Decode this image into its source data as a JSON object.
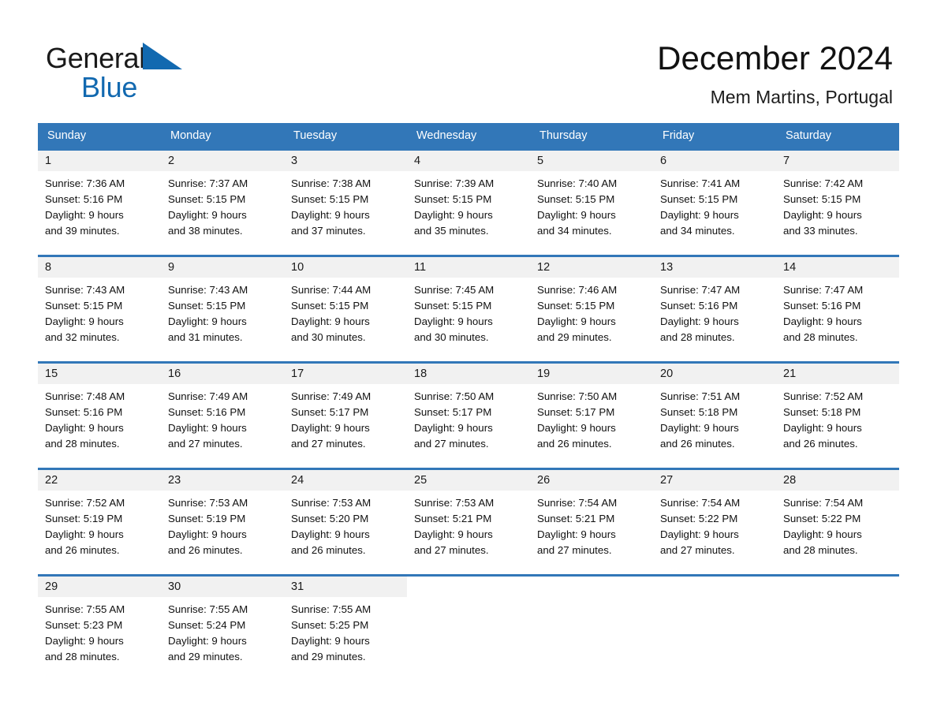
{
  "brand": {
    "word1": "General",
    "word2": "Blue",
    "triangle_color": "#1269b0",
    "text_color": "#1a1a1a"
  },
  "header": {
    "title": "December 2024",
    "subtitle": "Mem Martins, Portugal"
  },
  "theme": {
    "header_blue": "#3277b8",
    "daynum_band": "#f1f1f1",
    "page_background": "#ffffff"
  },
  "calendar": {
    "weekday_headers": [
      "Sunday",
      "Monday",
      "Tuesday",
      "Wednesday",
      "Thursday",
      "Friday",
      "Saturday"
    ],
    "weeks": [
      [
        {
          "day": "1",
          "sunrise": "Sunrise: 7:36 AM",
          "sunset": "Sunset: 5:16 PM",
          "daylight1": "Daylight: 9 hours",
          "daylight2": "and 39 minutes."
        },
        {
          "day": "2",
          "sunrise": "Sunrise: 7:37 AM",
          "sunset": "Sunset: 5:15 PM",
          "daylight1": "Daylight: 9 hours",
          "daylight2": "and 38 minutes."
        },
        {
          "day": "3",
          "sunrise": "Sunrise: 7:38 AM",
          "sunset": "Sunset: 5:15 PM",
          "daylight1": "Daylight: 9 hours",
          "daylight2": "and 37 minutes."
        },
        {
          "day": "4",
          "sunrise": "Sunrise: 7:39 AM",
          "sunset": "Sunset: 5:15 PM",
          "daylight1": "Daylight: 9 hours",
          "daylight2": "and 35 minutes."
        },
        {
          "day": "5",
          "sunrise": "Sunrise: 7:40 AM",
          "sunset": "Sunset: 5:15 PM",
          "daylight1": "Daylight: 9 hours",
          "daylight2": "and 34 minutes."
        },
        {
          "day": "6",
          "sunrise": "Sunrise: 7:41 AM",
          "sunset": "Sunset: 5:15 PM",
          "daylight1": "Daylight: 9 hours",
          "daylight2": "and 34 minutes."
        },
        {
          "day": "7",
          "sunrise": "Sunrise: 7:42 AM",
          "sunset": "Sunset: 5:15 PM",
          "daylight1": "Daylight: 9 hours",
          "daylight2": "and 33 minutes."
        }
      ],
      [
        {
          "day": "8",
          "sunrise": "Sunrise: 7:43 AM",
          "sunset": "Sunset: 5:15 PM",
          "daylight1": "Daylight: 9 hours",
          "daylight2": "and 32 minutes."
        },
        {
          "day": "9",
          "sunrise": "Sunrise: 7:43 AM",
          "sunset": "Sunset: 5:15 PM",
          "daylight1": "Daylight: 9 hours",
          "daylight2": "and 31 minutes."
        },
        {
          "day": "10",
          "sunrise": "Sunrise: 7:44 AM",
          "sunset": "Sunset: 5:15 PM",
          "daylight1": "Daylight: 9 hours",
          "daylight2": "and 30 minutes."
        },
        {
          "day": "11",
          "sunrise": "Sunrise: 7:45 AM",
          "sunset": "Sunset: 5:15 PM",
          "daylight1": "Daylight: 9 hours",
          "daylight2": "and 30 minutes."
        },
        {
          "day": "12",
          "sunrise": "Sunrise: 7:46 AM",
          "sunset": "Sunset: 5:15 PM",
          "daylight1": "Daylight: 9 hours",
          "daylight2": "and 29 minutes."
        },
        {
          "day": "13",
          "sunrise": "Sunrise: 7:47 AM",
          "sunset": "Sunset: 5:16 PM",
          "daylight1": "Daylight: 9 hours",
          "daylight2": "and 28 minutes."
        },
        {
          "day": "14",
          "sunrise": "Sunrise: 7:47 AM",
          "sunset": "Sunset: 5:16 PM",
          "daylight1": "Daylight: 9 hours",
          "daylight2": "and 28 minutes."
        }
      ],
      [
        {
          "day": "15",
          "sunrise": "Sunrise: 7:48 AM",
          "sunset": "Sunset: 5:16 PM",
          "daylight1": "Daylight: 9 hours",
          "daylight2": "and 28 minutes."
        },
        {
          "day": "16",
          "sunrise": "Sunrise: 7:49 AM",
          "sunset": "Sunset: 5:16 PM",
          "daylight1": "Daylight: 9 hours",
          "daylight2": "and 27 minutes."
        },
        {
          "day": "17",
          "sunrise": "Sunrise: 7:49 AM",
          "sunset": "Sunset: 5:17 PM",
          "daylight1": "Daylight: 9 hours",
          "daylight2": "and 27 minutes."
        },
        {
          "day": "18",
          "sunrise": "Sunrise: 7:50 AM",
          "sunset": "Sunset: 5:17 PM",
          "daylight1": "Daylight: 9 hours",
          "daylight2": "and 27 minutes."
        },
        {
          "day": "19",
          "sunrise": "Sunrise: 7:50 AM",
          "sunset": "Sunset: 5:17 PM",
          "daylight1": "Daylight: 9 hours",
          "daylight2": "and 26 minutes."
        },
        {
          "day": "20",
          "sunrise": "Sunrise: 7:51 AM",
          "sunset": "Sunset: 5:18 PM",
          "daylight1": "Daylight: 9 hours",
          "daylight2": "and 26 minutes."
        },
        {
          "day": "21",
          "sunrise": "Sunrise: 7:52 AM",
          "sunset": "Sunset: 5:18 PM",
          "daylight1": "Daylight: 9 hours",
          "daylight2": "and 26 minutes."
        }
      ],
      [
        {
          "day": "22",
          "sunrise": "Sunrise: 7:52 AM",
          "sunset": "Sunset: 5:19 PM",
          "daylight1": "Daylight: 9 hours",
          "daylight2": "and 26 minutes."
        },
        {
          "day": "23",
          "sunrise": "Sunrise: 7:53 AM",
          "sunset": "Sunset: 5:19 PM",
          "daylight1": "Daylight: 9 hours",
          "daylight2": "and 26 minutes."
        },
        {
          "day": "24",
          "sunrise": "Sunrise: 7:53 AM",
          "sunset": "Sunset: 5:20 PM",
          "daylight1": "Daylight: 9 hours",
          "daylight2": "and 26 minutes."
        },
        {
          "day": "25",
          "sunrise": "Sunrise: 7:53 AM",
          "sunset": "Sunset: 5:21 PM",
          "daylight1": "Daylight: 9 hours",
          "daylight2": "and 27 minutes."
        },
        {
          "day": "26",
          "sunrise": "Sunrise: 7:54 AM",
          "sunset": "Sunset: 5:21 PM",
          "daylight1": "Daylight: 9 hours",
          "daylight2": "and 27 minutes."
        },
        {
          "day": "27",
          "sunrise": "Sunrise: 7:54 AM",
          "sunset": "Sunset: 5:22 PM",
          "daylight1": "Daylight: 9 hours",
          "daylight2": "and 27 minutes."
        },
        {
          "day": "28",
          "sunrise": "Sunrise: 7:54 AM",
          "sunset": "Sunset: 5:22 PM",
          "daylight1": "Daylight: 9 hours",
          "daylight2": "and 28 minutes."
        }
      ],
      [
        {
          "day": "29",
          "sunrise": "Sunrise: 7:55 AM",
          "sunset": "Sunset: 5:23 PM",
          "daylight1": "Daylight: 9 hours",
          "daylight2": "and 28 minutes."
        },
        {
          "day": "30",
          "sunrise": "Sunrise: 7:55 AM",
          "sunset": "Sunset: 5:24 PM",
          "daylight1": "Daylight: 9 hours",
          "daylight2": "and 29 minutes."
        },
        {
          "day": "31",
          "sunrise": "Sunrise: 7:55 AM",
          "sunset": "Sunset: 5:25 PM",
          "daylight1": "Daylight: 9 hours",
          "daylight2": "and 29 minutes."
        },
        {
          "day": "",
          "sunrise": "",
          "sunset": "",
          "daylight1": "",
          "daylight2": ""
        },
        {
          "day": "",
          "sunrise": "",
          "sunset": "",
          "daylight1": "",
          "daylight2": ""
        },
        {
          "day": "",
          "sunrise": "",
          "sunset": "",
          "daylight1": "",
          "daylight2": ""
        },
        {
          "day": "",
          "sunrise": "",
          "sunset": "",
          "daylight1": "",
          "daylight2": ""
        }
      ]
    ]
  }
}
